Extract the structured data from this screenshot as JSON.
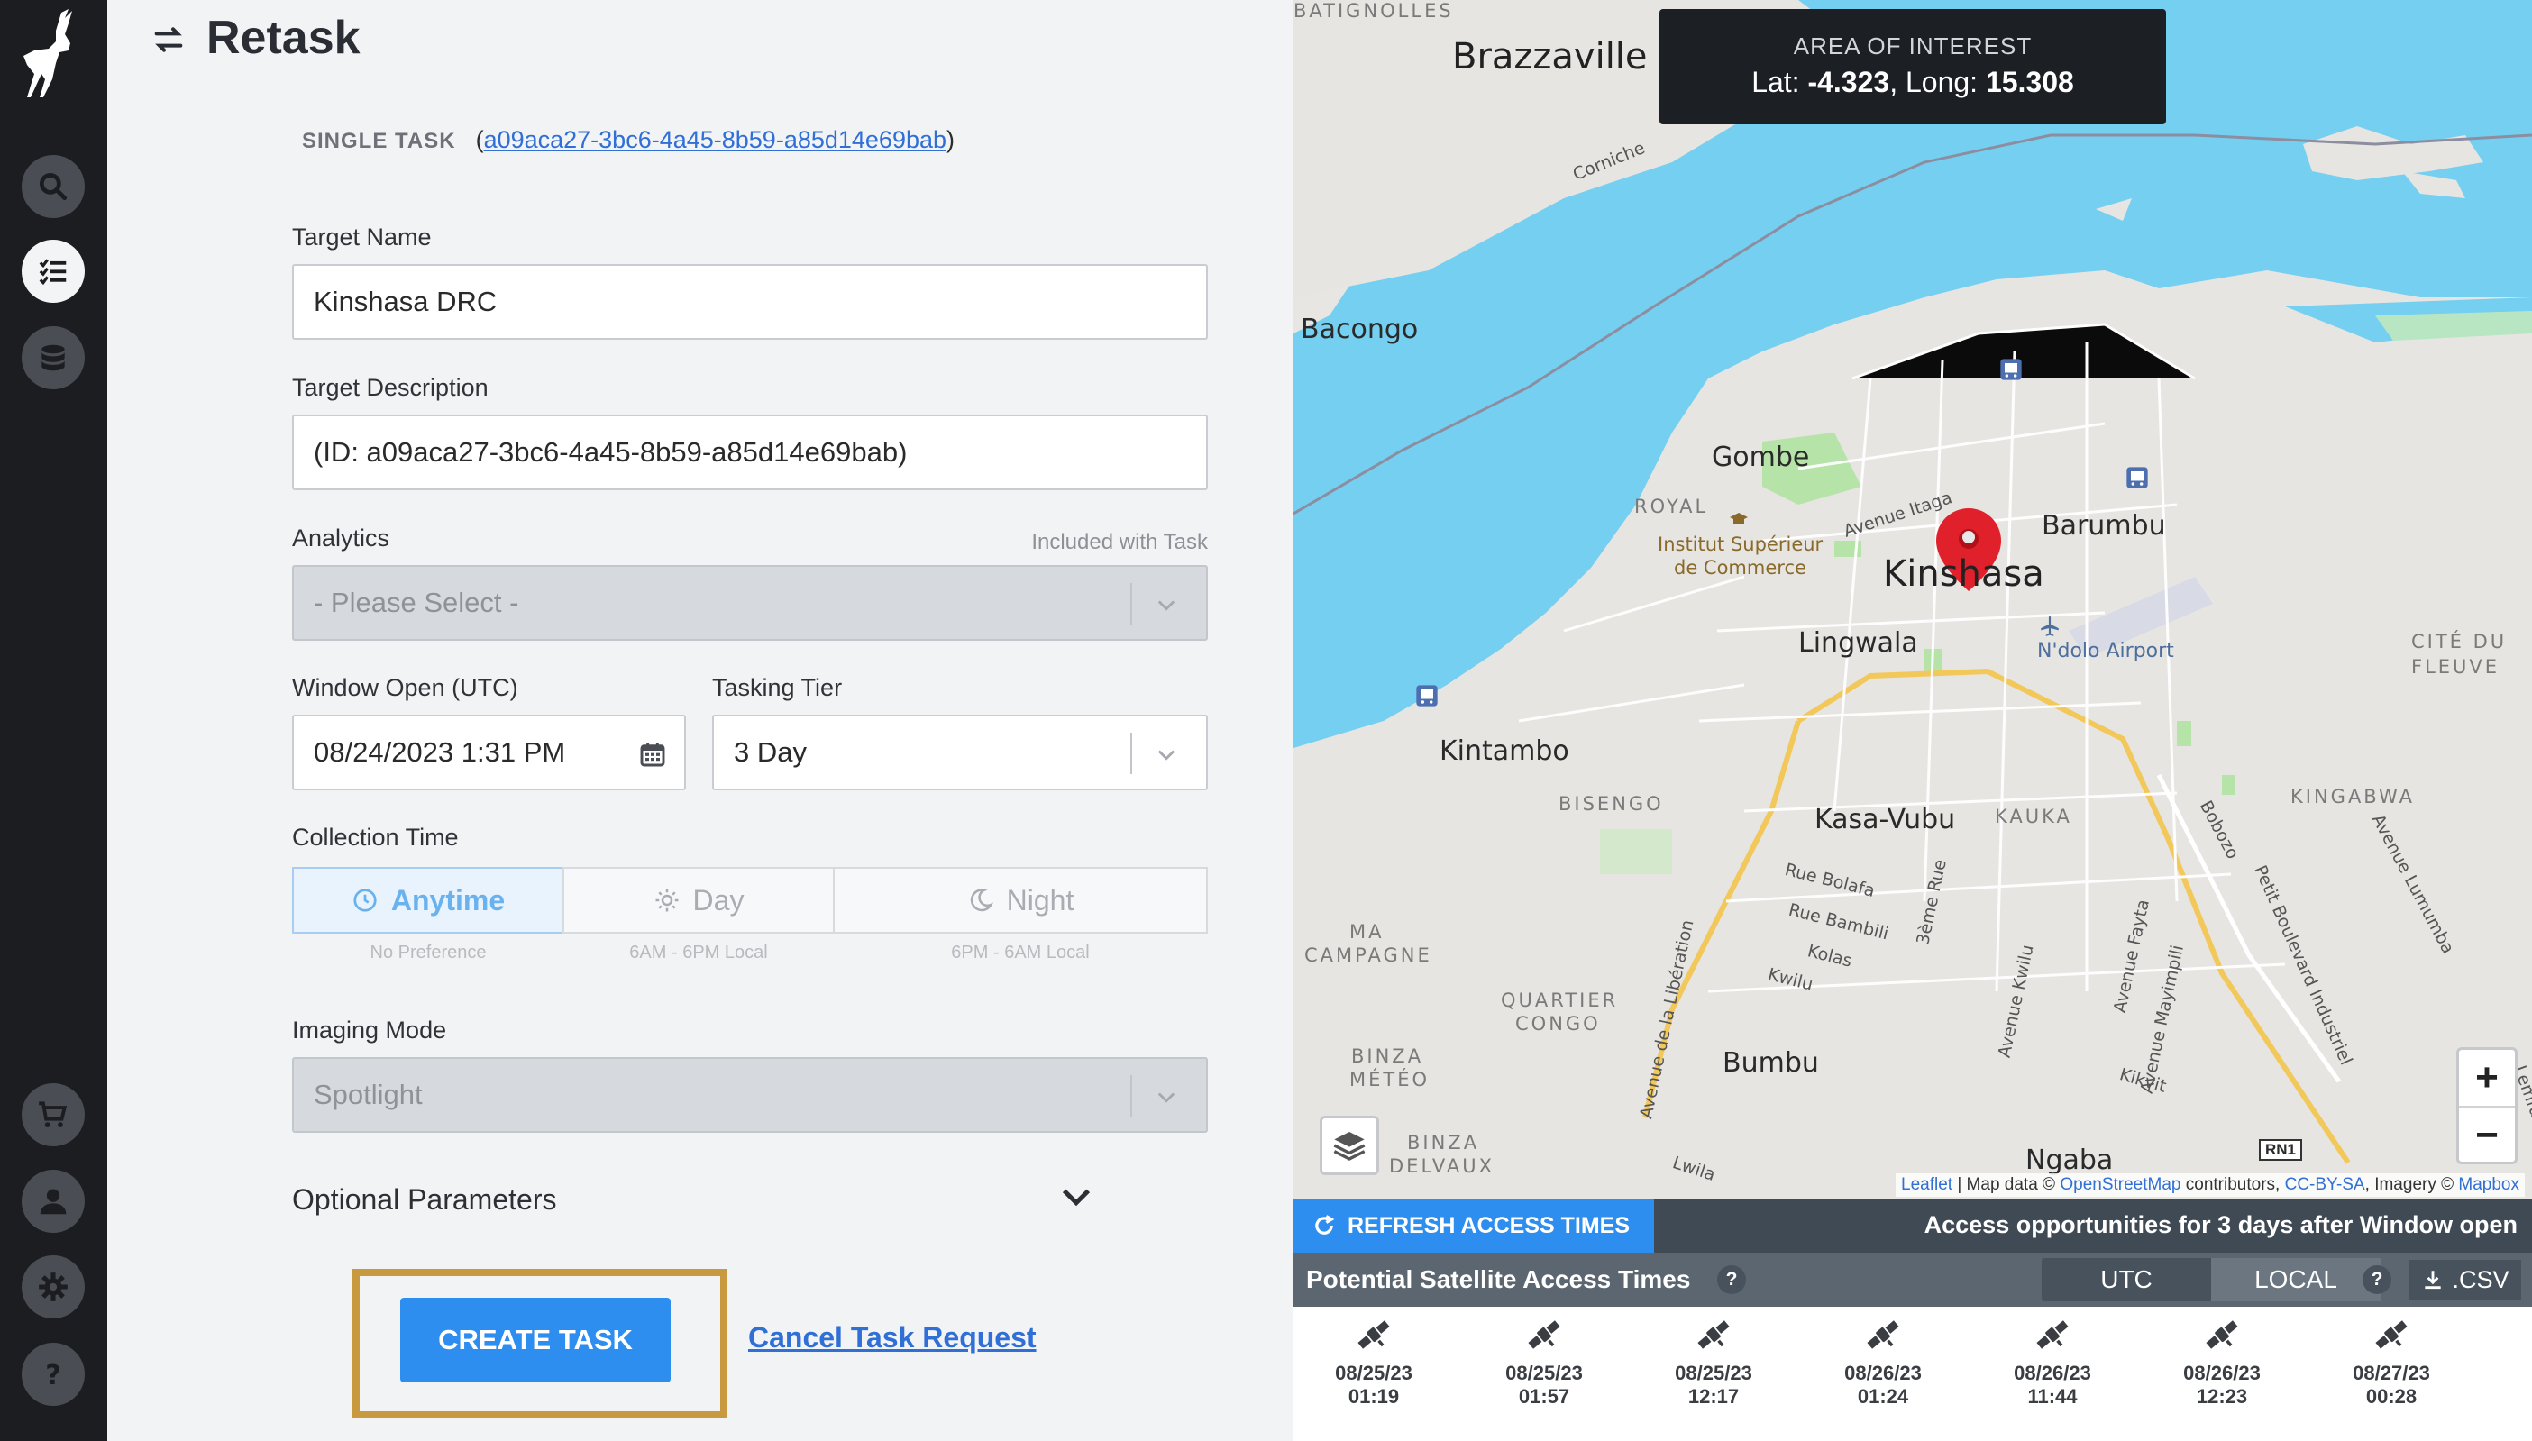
{
  "nav": {
    "items": [
      "search-icon",
      "task-list-icon",
      "database-icon",
      "cart-icon",
      "user-icon",
      "gear-icon",
      "help-icon"
    ],
    "active": "task-list-icon"
  },
  "header": {
    "title": "Retask"
  },
  "task": {
    "label": "SINGLE TASK",
    "open_paren": "(",
    "id": "a09aca27-3bc6-4a45-8b59-a85d14e69bab",
    "close_paren": ")"
  },
  "form": {
    "target_name_label": "Target Name",
    "target_name_value": "Kinshasa DRC",
    "target_desc_label": "Target Description",
    "target_desc_value": "(ID: a09aca27-3bc6-4a45-8b59-a85d14e69bab)",
    "analytics_label": "Analytics",
    "analytics_hint": "Included with Task",
    "analytics_value": "- Please Select -",
    "window_open_label": "Window Open (UTC)",
    "window_open_value": "08/24/2023 1:31 PM",
    "tier_label": "Tasking Tier",
    "tier_value": "3 Day",
    "collection_label": "Collection Time",
    "collection_options": [
      {
        "label": "Anytime",
        "sub": "No Preference",
        "icon": "clock-icon"
      },
      {
        "label": "Day",
        "sub": "6AM - 6PM Local",
        "icon": "sun-icon"
      },
      {
        "label": "Night",
        "sub": "6PM - 6AM Local",
        "icon": "moon-icon"
      }
    ],
    "collection_selected": "Anytime",
    "imaging_label": "Imaging Mode",
    "imaging_value": "Spotlight",
    "optional_label": "Optional Parameters",
    "create_label": "CREATE TASK",
    "cancel_label": "Cancel Task Request"
  },
  "map": {
    "aoi_title": "AREA OF INTEREST",
    "lat_label": "Lat: ",
    "lat_value": "-4.323",
    "long_label": ", Long: ",
    "long_value": "15.308",
    "labels": {
      "batignolles": "BATIGNOLLES",
      "brazzaville": "Brazzaville",
      "corniche": "Corniche",
      "bacongo": "Bacongo",
      "gombe": "Gombe",
      "royal": "ROYAL",
      "institut1": "Institut Supérieur",
      "institut2": "de Commerce",
      "avenue_itaga": "Avenue Itaga",
      "kinshasa": "Kinshasa",
      "barumbu": "Barumbu",
      "lingwala": "Lingwala",
      "ndolo": "N'dolo Airport",
      "cite1": "CITÉ DU",
      "cite2": "FLEUVE",
      "kintambo": "Kintambo",
      "bisengo": "BISENGO",
      "kasavubu": "Kasa-Vubu",
      "kauka": "KAUKA",
      "kingabwa": "KINGABWA",
      "bobozo": "Bobozo",
      "lumumba": "Avenue Lumumba",
      "ma1": "MA",
      "campagne": "CAMPAGNE",
      "rue_bolafa": "Rue Bolafa",
      "rue_bambili": "Rue Bambili",
      "kolas": "Kolas",
      "kwilu": "Kwilu",
      "rue3": "3ème Rue",
      "quartier": "QUARTIER",
      "congo": "CONGO",
      "liberation": "Avenue de la Libération",
      "av_kwilu": "Avenue Kwilu",
      "av_fayta": "Avenue Fayta",
      "mayimpili": "Avenue Mayimpili",
      "petit_blvd": "Petit Boulevard Industriel",
      "kikvit": "Kikvit",
      "binza1": "BINZA",
      "meteo": "MÉTÉO",
      "bumbu": "Bumbu",
      "binza2": "BINZA",
      "delvaux": "DELVAUX",
      "lwila": "Lwila",
      "ngaba": "Ngaba",
      "rn1": "RN1",
      "lemfu": "Lemfu"
    },
    "zoom_in": "+",
    "zoom_out": "−",
    "attribution": {
      "leaflet": "Leaflet",
      "sep": " | Map data © ",
      "osm": "OpenStreetMap",
      "contrib": " contributors, ",
      "ccbysa": "CC-BY-SA",
      "imagery": ", Imagery © ",
      "mapbox": "Mapbox"
    }
  },
  "access": {
    "refresh_label": "REFRESH ACCESS TIMES",
    "note": "Access opportunities for 3 days after Window open",
    "title": "Potential Satellite Access Times",
    "help": "?",
    "tz_options": [
      "UTC",
      "LOCAL"
    ],
    "tz_selected": "LOCAL",
    "csv_label": ".CSV",
    "passes": [
      {
        "date": "08/25/23",
        "time": "01:19"
      },
      {
        "date": "08/25/23",
        "time": "01:57"
      },
      {
        "date": "08/25/23",
        "time": "12:17"
      },
      {
        "date": "08/26/23",
        "time": "01:24"
      },
      {
        "date": "08/26/23",
        "time": "11:44"
      },
      {
        "date": "08/26/23",
        "time": "12:23"
      },
      {
        "date": "08/27/23",
        "time": "00:28"
      }
    ]
  }
}
